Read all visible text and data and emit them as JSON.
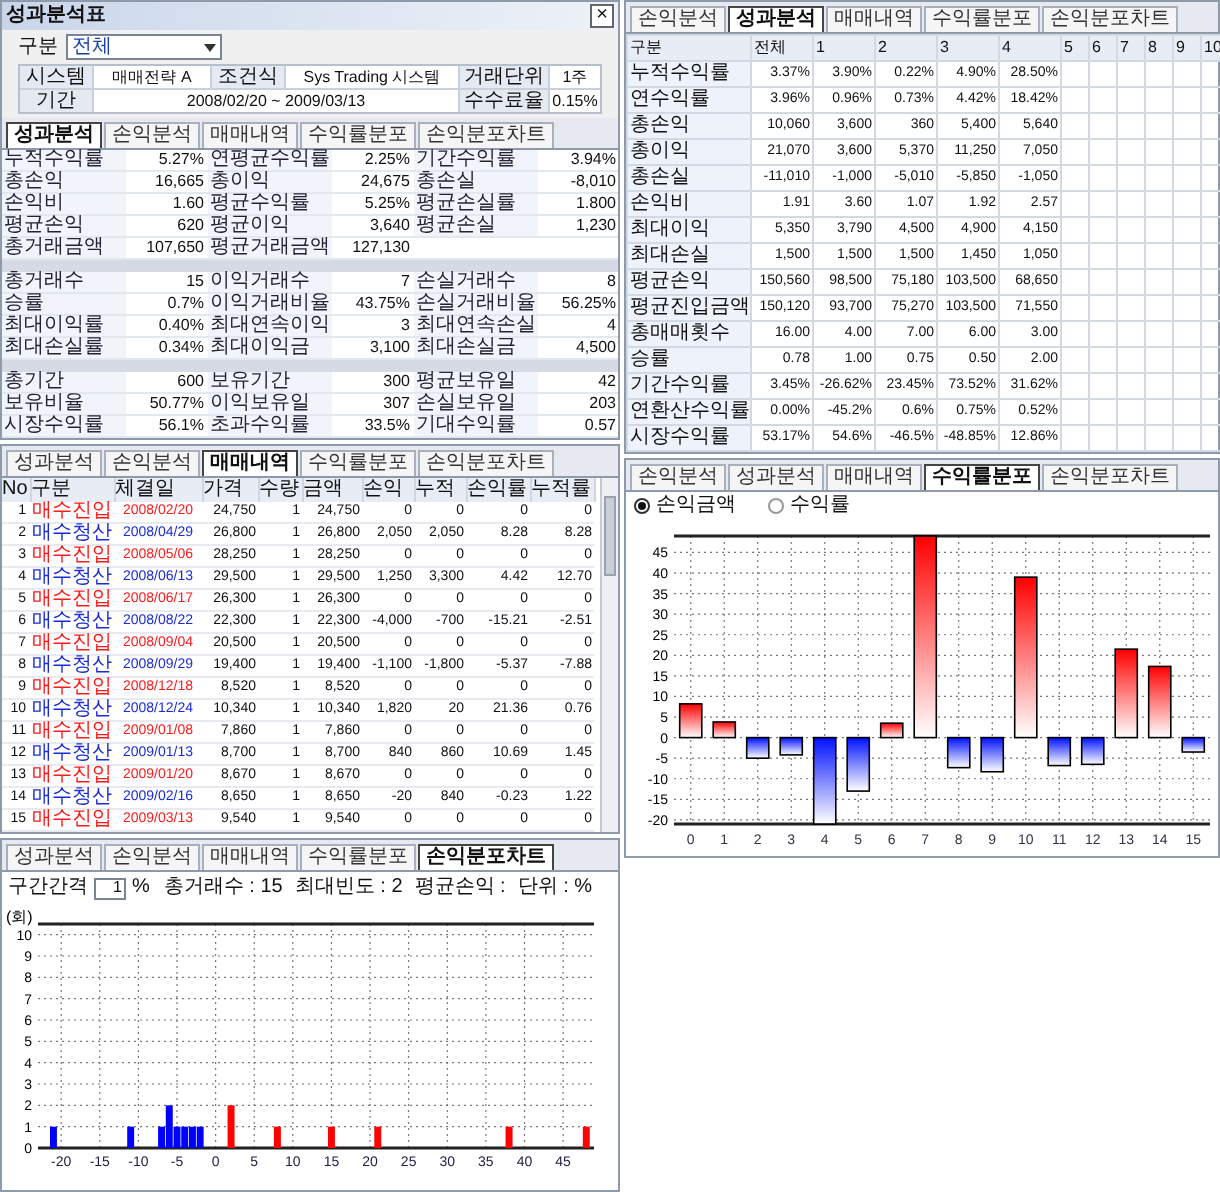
{
  "window": {
    "title": "성과분석표",
    "close": "×"
  },
  "filter": {
    "label": "구분",
    "value": "전체"
  },
  "info": [
    {
      "label": "시스템",
      "value": "매매전략 A"
    },
    {
      "label": "조건식",
      "value": "Sys Trading 시스템"
    },
    {
      "label": "거래단위",
      "value": "1주"
    },
    {
      "label": "기간",
      "value": "2008/02/20 ~ 2009/03/13"
    },
    {
      "label": "수수료율",
      "value": "0.15%"
    }
  ],
  "summary": {
    "tabs": [
      {
        "label": "성과분석",
        "selected": true
      },
      {
        "label": "손익분석",
        "selected": false
      },
      {
        "label": "매매내역",
        "selected": false
      },
      {
        "label": "수익률분포",
        "selected": false
      },
      {
        "label": "손익분포차트",
        "selected": false
      }
    ],
    "groups": [
      [
        [
          {
            "label": "누적수익률",
            "value": "5.27%"
          },
          {
            "label": "연평균수익률",
            "value": "2.25%"
          },
          {
            "label": "기간수익률",
            "value": "3.94%"
          }
        ],
        [
          {
            "label": "총손익",
            "value": "16,665"
          },
          {
            "label": "총이익",
            "value": "24,675"
          },
          {
            "label": "총손실",
            "value": "-8,010"
          }
        ],
        [
          {
            "label": "손익비",
            "value": "1.60"
          },
          {
            "label": "평균수익률",
            "value": "5.25%"
          },
          {
            "label": "평균손실률",
            "value": "1.800"
          }
        ],
        [
          {
            "label": "평균손익",
            "value": "620"
          },
          {
            "label": "평균이익",
            "value": "3,640"
          },
          {
            "label": "평균손실",
            "value": "1,230"
          }
        ],
        [
          {
            "label": "총거래금액",
            "value": "107,650"
          },
          {
            "label": "평균거래금액",
            "value": "127,130"
          }
        ]
      ],
      [
        [
          {
            "label": "총거래수",
            "value": "15"
          },
          {
            "label": "이익거래수",
            "value": "7"
          },
          {
            "label": "손실거래수",
            "value": "8"
          }
        ],
        [
          {
            "label": "승률",
            "value": "0.7%"
          },
          {
            "label": "이익거래비율",
            "value": "43.75%"
          },
          {
            "label": "손실거래비율",
            "value": "56.25%"
          }
        ],
        [
          {
            "label": "최대이익률",
            "value": "0.40%"
          },
          {
            "label": "최대연속이익",
            "value": "3"
          },
          {
            "label": "최대연속손실",
            "value": "4"
          }
        ],
        [
          {
            "label": "최대손실률",
            "value": "0.34%"
          },
          {
            "label": "최대이익금",
            "value": "3,100"
          },
          {
            "label": "최대손실금",
            "value": "4,500"
          }
        ]
      ],
      [
        [
          {
            "label": "총기간",
            "value": "600"
          },
          {
            "label": "보유기간",
            "value": "300"
          },
          {
            "label": "평균보유일",
            "value": "42"
          }
        ],
        [
          {
            "label": "보유비율",
            "value": "50.77%"
          },
          {
            "label": "이익보유일",
            "value": "307"
          },
          {
            "label": "손실보유일",
            "value": "203"
          }
        ],
        [
          {
            "label": "시장수익률",
            "value": "56.1%"
          },
          {
            "label": "초과수익률",
            "value": "33.5%"
          },
          {
            "label": "기대수익률",
            "value": "0.57"
          }
        ]
      ]
    ]
  },
  "trades": {
    "tabs": [
      {
        "label": "성과분석",
        "selected": false
      },
      {
        "label": "손익분석",
        "selected": false
      },
      {
        "label": "매매내역",
        "selected": true
      },
      {
        "label": "수익률분포",
        "selected": false
      },
      {
        "label": "손익분포차트",
        "selected": false
      }
    ],
    "columns": [
      "No",
      "구분",
      "체결일",
      "가격",
      "수량",
      "금액",
      "손익",
      "누적",
      "손익률",
      "누적률"
    ],
    "rows": [
      {
        "kind": "entry",
        "cells": [
          "1",
          "매수진입",
          "2008/02/20",
          "24,750",
          "1",
          "24,750",
          "0",
          "0",
          "0",
          "0"
        ]
      },
      {
        "kind": "exit",
        "cells": [
          "2",
          "매수청산",
          "2008/04/29",
          "26,800",
          "1",
          "26,800",
          "2,050",
          "2,050",
          "8.28",
          "8.28"
        ]
      },
      {
        "kind": "entry",
        "cells": [
          "3",
          "매수진입",
          "2008/05/06",
          "28,250",
          "1",
          "28,250",
          "0",
          "0",
          "0",
          "0"
        ]
      },
      {
        "kind": "exit",
        "cells": [
          "4",
          "매수청산",
          "2008/06/13",
          "29,500",
          "1",
          "29,500",
          "1,250",
          "3,300",
          "4.42",
          "12.70"
        ]
      },
      {
        "kind": "entry",
        "cells": [
          "5",
          "매수진입",
          "2008/06/17",
          "26,300",
          "1",
          "26,300",
          "0",
          "0",
          "0",
          "0"
        ]
      },
      {
        "kind": "exit",
        "cells": [
          "6",
          "매수청산",
          "2008/08/22",
          "22,300",
          "1",
          "22,300",
          "-4,000",
          "-700",
          "-15.21",
          "-2.51"
        ]
      },
      {
        "kind": "entry",
        "cells": [
          "7",
          "매수진입",
          "2008/09/04",
          "20,500",
          "1",
          "20,500",
          "0",
          "0",
          "0",
          "0"
        ]
      },
      {
        "kind": "exit",
        "cells": [
          "8",
          "매수청산",
          "2008/09/29",
          "19,400",
          "1",
          "19,400",
          "-1,100",
          "-1,800",
          "-5.37",
          "-7.88"
        ]
      },
      {
        "kind": "entry",
        "cells": [
          "9",
          "매수진입",
          "2008/12/18",
          "8,520",
          "1",
          "8,520",
          "0",
          "0",
          "0",
          "0"
        ]
      },
      {
        "kind": "exit",
        "cells": [
          "10",
          "매수청산",
          "2008/12/24",
          "10,340",
          "1",
          "10,340",
          "1,820",
          "20",
          "21.36",
          "0.76"
        ]
      },
      {
        "kind": "entry",
        "cells": [
          "11",
          "매수진입",
          "2009/01/08",
          "7,860",
          "1",
          "7,860",
          "0",
          "0",
          "0",
          "0"
        ]
      },
      {
        "kind": "exit",
        "cells": [
          "12",
          "매수청산",
          "2009/01/13",
          "8,700",
          "1",
          "8,700",
          "840",
          "860",
          "10.69",
          "1.45"
        ]
      },
      {
        "kind": "entry",
        "cells": [
          "13",
          "매수진입",
          "2009/01/20",
          "8,670",
          "1",
          "8,670",
          "0",
          "0",
          "0",
          "0"
        ]
      },
      {
        "kind": "exit",
        "cells": [
          "14",
          "매수청산",
          "2009/02/16",
          "8,650",
          "1",
          "8,650",
          "-20",
          "840",
          "-0.23",
          "1.22"
        ]
      },
      {
        "kind": "entry",
        "cells": [
          "15",
          "매수진입",
          "2009/03/13",
          "9,540",
          "1",
          "9,540",
          "0",
          "0",
          "0",
          "0"
        ]
      }
    ]
  },
  "distribution": {
    "tabs": [
      {
        "label": "성과분석",
        "selected": false
      },
      {
        "label": "손익분석",
        "selected": false
      },
      {
        "label": "매매내역",
        "selected": false
      },
      {
        "label": "수익률분포",
        "selected": false
      },
      {
        "label": "손익분포차트",
        "selected": true
      }
    ],
    "interval_label": "구간간격",
    "interval": "1",
    "interval_unit": "%",
    "stats": [
      "총거래수 : 15",
      "최대빈도 : 2",
      "평균손익 :",
      "단위 : %"
    ],
    "chart_data": {
      "type": "bar",
      "ylabel": "(회)",
      "x": [
        -21,
        -11,
        -7,
        -6,
        -5,
        -4,
        -3,
        -2,
        2,
        8,
        15,
        21,
        38,
        48
      ],
      "series": [
        {
          "color": "#0000ff",
          "values": [
            1,
            1,
            1,
            2,
            1,
            1,
            1,
            1,
            null,
            null,
            null,
            null,
            null,
            null
          ]
        },
        {
          "color": "#ff0000",
          "values": [
            null,
            null,
            null,
            null,
            null,
            null,
            null,
            null,
            2,
            1,
            1,
            1,
            1,
            1
          ]
        }
      ],
      "grid": true,
      "xlim": [
        -23,
        49
      ],
      "ylim": [
        0,
        10.5
      ],
      "xticks": [
        -20,
        -15,
        -10,
        -5,
        0,
        5,
        10,
        15,
        20,
        25,
        30,
        35,
        40,
        45
      ],
      "yticks": [
        0,
        1,
        2,
        3,
        4,
        5,
        6,
        7,
        8,
        9,
        10
      ]
    }
  },
  "analysis": {
    "tabs": [
      {
        "label": "손익분석",
        "selected": false
      },
      {
        "label": "성과분석",
        "selected": true
      },
      {
        "label": "매매내역",
        "selected": false
      },
      {
        "label": "수익률분포",
        "selected": false
      },
      {
        "label": "손익분포차트",
        "selected": false
      }
    ],
    "columns": [
      "구분",
      "전체",
      "1",
      "2",
      "3",
      "4",
      "5",
      "6",
      "7",
      "8",
      "9",
      "10"
    ],
    "rows": [
      {
        "label": "누적수익률",
        "values": [
          "3.37%",
          "3.90%",
          "0.22%",
          "4.90%",
          "28.50%"
        ]
      },
      {
        "label": "연수익률",
        "values": [
          "3.96%",
          "0.96%",
          "0.73%",
          "4.42%",
          "18.42%"
        ]
      },
      {
        "label": "총손익",
        "values": [
          "10,060",
          "3,600",
          "360",
          "5,400",
          "5,640"
        ]
      },
      {
        "label": "총이익",
        "values": [
          "21,070",
          "3,600",
          "5,370",
          "11,250",
          "7,050"
        ]
      },
      {
        "label": "총손실",
        "values": [
          "-11,010",
          "-1,000",
          "-5,010",
          "-5,850",
          "-1,050"
        ]
      },
      {
        "label": "손익비",
        "values": [
          "1.91",
          "3.60",
          "1.07",
          "1.92",
          "2.57"
        ]
      },
      {
        "label": "최대이익",
        "values": [
          "5,350",
          "3,790",
          "4,500",
          "4,900",
          "4,150"
        ]
      },
      {
        "label": "최대손실",
        "values": [
          "1,500",
          "1,500",
          "1,500",
          "1,450",
          "1,050"
        ]
      },
      {
        "label": "평균손익",
        "values": [
          "150,560",
          "98,500",
          "75,180",
          "103,500",
          "68,650"
        ]
      },
      {
        "label": "평균진입금액",
        "values": [
          "150,120",
          "93,700",
          "75,270",
          "103,500",
          "71,550"
        ]
      },
      {
        "label": "총매매횟수",
        "values": [
          "16.00",
          "4.00",
          "7.00",
          "6.00",
          "3.00"
        ]
      },
      {
        "label": "승률",
        "values": [
          "0.78",
          "1.00",
          "0.75",
          "0.50",
          "2.00"
        ]
      },
      {
        "label": "기간수익률",
        "values": [
          "3.45%",
          "-26.62%",
          "23.45%",
          "73.52%",
          "31.62%"
        ]
      },
      {
        "label": "연환산수익률",
        "values": [
          "0.00%",
          "-45.2%",
          "0.6%",
          "0.75%",
          "0.52%"
        ]
      },
      {
        "label": "시장수익률",
        "values": [
          "53.17%",
          "54.6%",
          "-46.5%",
          "-48.85%",
          "12.86%"
        ]
      }
    ]
  },
  "pnl_chart": {
    "tabs": [
      {
        "label": "손익분석",
        "selected": false
      },
      {
        "label": "성과분석",
        "selected": false
      },
      {
        "label": "매매내역",
        "selected": false
      },
      {
        "label": "수익률분포",
        "selected": true
      },
      {
        "label": "손익분포차트",
        "selected": false
      }
    ],
    "options": [
      {
        "label": "손익금액",
        "selected": true
      },
      {
        "label": "수익률",
        "selected": false
      }
    ],
    "chart_data": {
      "type": "bar",
      "categories": [
        "0",
        "1",
        "2",
        "3",
        "4",
        "5",
        "6",
        "7",
        "8",
        "9",
        "10",
        "11",
        "12",
        "13",
        "14",
        "15"
      ],
      "series": [
        {
          "values": [
            8.2,
            3.8,
            -5,
            -4.2,
            -21,
            -13,
            3.5,
            49,
            -7.3,
            -8.3,
            39,
            -6.8,
            -6.5,
            21.5,
            17.3,
            -3.5
          ]
        }
      ],
      "grid": true,
      "ylim": [
        -21,
        49
      ],
      "yticks": [
        -20,
        -15,
        -10,
        -5,
        0,
        5,
        10,
        15,
        20,
        25,
        30,
        35,
        40,
        45
      ]
    }
  }
}
